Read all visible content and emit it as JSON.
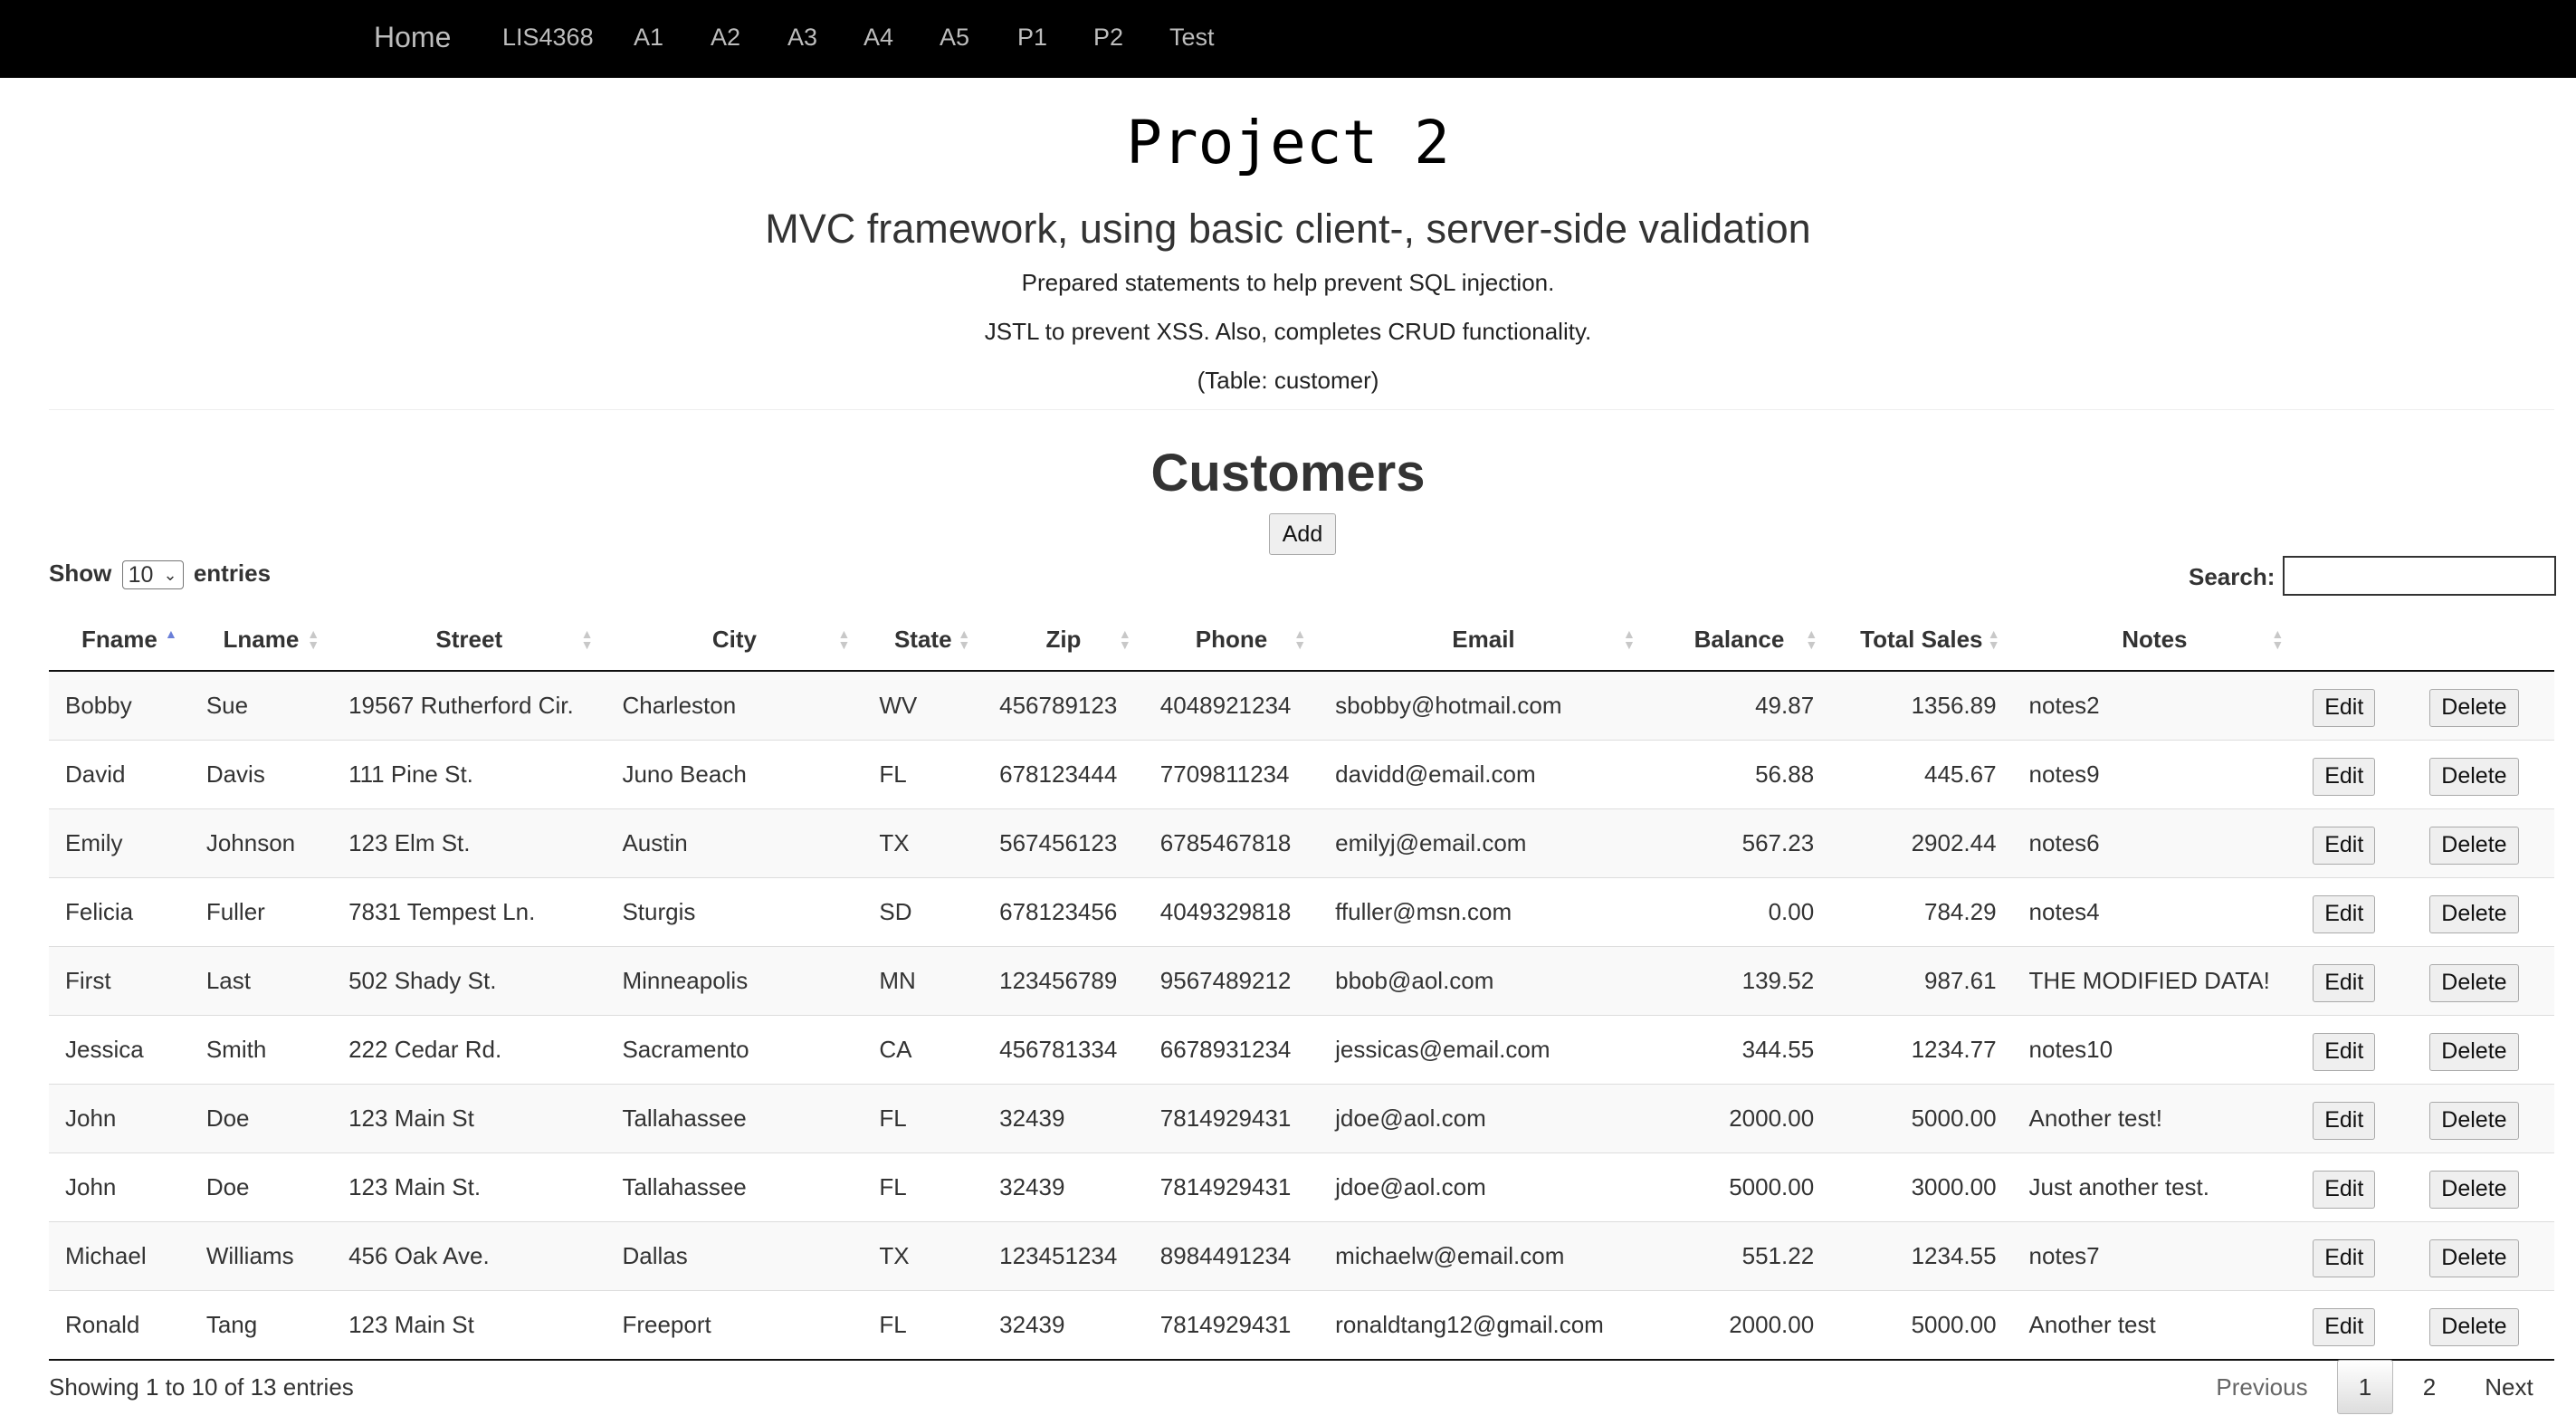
{
  "nav": {
    "brand": "Home",
    "links": [
      "LIS4368",
      "A1",
      "A2",
      "A3",
      "A4",
      "A5",
      "P1",
      "P2",
      "Test"
    ]
  },
  "header": {
    "title": "Project 2",
    "subtitle": "MVC framework, using basic client-, server-side validation",
    "lines": [
      "Prepared statements to help prevent SQL injection.",
      "JSTL to prevent XSS. Also, completes CRUD functionality.",
      "(Table: customer)"
    ]
  },
  "section": {
    "heading": "Customers",
    "add_label": "Add"
  },
  "controls": {
    "show_label": "Show",
    "entries_label": "entries",
    "page_length": "10",
    "search_label": "Search:",
    "search_value": ""
  },
  "table": {
    "columns": [
      "Fname",
      "Lname",
      "Street",
      "City",
      "State",
      "Zip",
      "Phone",
      "Email",
      "Balance",
      "Total Sales",
      "Notes"
    ],
    "sorted_column": "Fname",
    "sort_direction": "ascending",
    "edit_label": "Edit",
    "delete_label": "Delete",
    "rows": [
      [
        "Bobby",
        "Sue",
        "19567 Rutherford Cir.",
        "Charleston",
        "WV",
        "456789123",
        "4048921234",
        "sbobby@hotmail.com",
        "49.87",
        "1356.89",
        "notes2"
      ],
      [
        "David",
        "Davis",
        "111 Pine St.",
        "Juno Beach",
        "FL",
        "678123444",
        "7709811234",
        "davidd@email.com",
        "56.88",
        "445.67",
        "notes9"
      ],
      [
        "Emily",
        "Johnson",
        "123 Elm St.",
        "Austin",
        "TX",
        "567456123",
        "6785467818",
        "emilyj@email.com",
        "567.23",
        "2902.44",
        "notes6"
      ],
      [
        "Felicia",
        "Fuller",
        "7831 Tempest Ln.",
        "Sturgis",
        "SD",
        "678123456",
        "4049329818",
        "ffuller@msn.com",
        "0.00",
        "784.29",
        "notes4"
      ],
      [
        "First",
        "Last",
        "502 Shady St.",
        "Minneapolis",
        "MN",
        "123456789",
        "9567489212",
        "bbob@aol.com",
        "139.52",
        "987.61",
        "THE MODIFIED DATA!"
      ],
      [
        "Jessica",
        "Smith",
        "222 Cedar Rd.",
        "Sacramento",
        "CA",
        "456781334",
        "6678931234",
        "jessicas@email.com",
        "344.55",
        "1234.77",
        "notes10"
      ],
      [
        "John",
        "Doe",
        "123 Main St",
        "Tallahassee",
        "FL",
        "32439",
        "7814929431",
        "jdoe@aol.com",
        "2000.00",
        "5000.00",
        "Another test!"
      ],
      [
        "John",
        "Doe",
        "123 Main St.",
        "Tallahassee",
        "FL",
        "32439",
        "7814929431",
        "jdoe@aol.com",
        "5000.00",
        "3000.00",
        "Just another test."
      ],
      [
        "Michael",
        "Williams",
        "456 Oak Ave.",
        "Dallas",
        "TX",
        "123451234",
        "8984491234",
        "michaelw@email.com",
        "551.22",
        "1234.55",
        "notes7"
      ],
      [
        "Ronald",
        "Tang",
        "123 Main St",
        "Freeport",
        "FL",
        "32439",
        "7814929431",
        "ronaldtang12@gmail.com",
        "2000.00",
        "5000.00",
        "Another test"
      ]
    ]
  },
  "footer": {
    "info": "Showing 1 to 10 of 13 entries",
    "prev_label": "Previous",
    "pages": [
      "1",
      "2"
    ],
    "current_page": "1",
    "next_label": "Next"
  },
  "colors": {
    "navbar_bg": "#000000",
    "nav_text": "#bdbdbd",
    "sort_active": "#6a7fd8",
    "row_stripe": "#f9f9f9"
  }
}
